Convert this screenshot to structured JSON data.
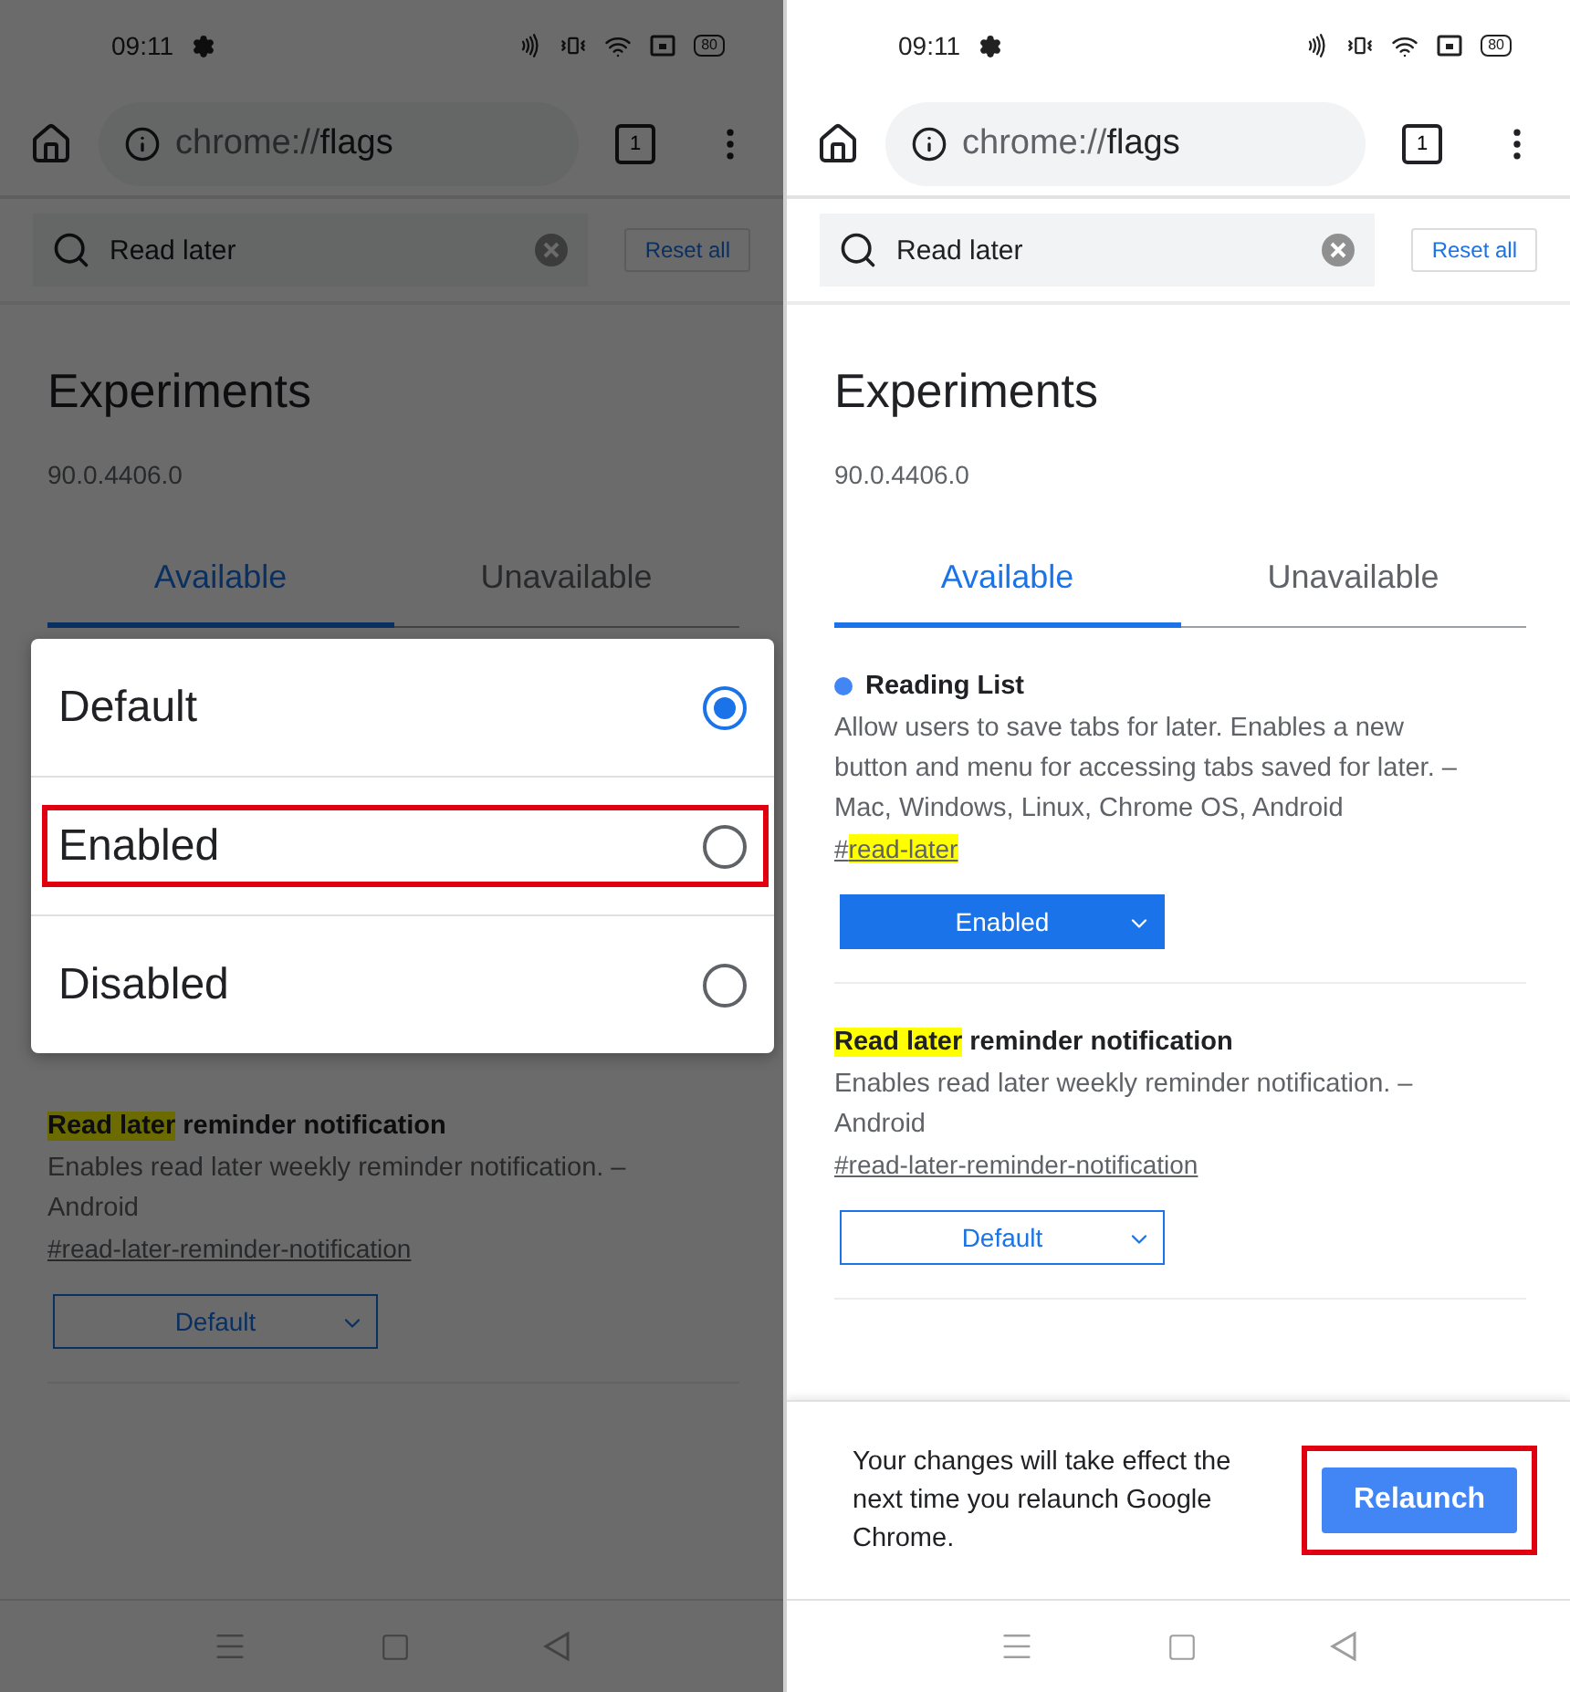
{
  "screens": [
    {
      "dimmed": true,
      "status": {
        "time": "09:11",
        "battery": "80"
      },
      "toolbar": {
        "url_scheme": "chrome://",
        "url_path": "flags",
        "tab_count": "1"
      },
      "search": {
        "value": "Read later",
        "reset_label": "Reset all"
      },
      "title": "Experiments",
      "version": "90.0.4406.0",
      "tabs": [
        {
          "label": "Available",
          "selected": true
        },
        {
          "label": "Unavailable",
          "selected": false
        }
      ],
      "dialog": {
        "options": [
          {
            "label": "Default",
            "selected": true,
            "annotated": false
          },
          {
            "label": "Enabled",
            "selected": false,
            "annotated": true
          },
          {
            "label": "Disabled",
            "selected": false,
            "annotated": false
          }
        ]
      },
      "flags": [
        {
          "modified": false,
          "title_parts": [
            {
              "text": "Read later",
              "highlighted": true
            },
            {
              "text": " reminder notification",
              "highlighted": false
            }
          ],
          "description": "Enables read later weekly reminder notification. – Android",
          "link_parts": [
            {
              "text": "#read-later-reminder-notification",
              "highlighted": false
            }
          ],
          "value": "Default"
        }
      ]
    },
    {
      "dimmed": false,
      "status": {
        "time": "09:11",
        "battery": "80"
      },
      "toolbar": {
        "url_scheme": "chrome://",
        "url_path": "flags",
        "tab_count": "1"
      },
      "search": {
        "value": "Read later",
        "reset_label": "Reset all"
      },
      "title": "Experiments",
      "version": "90.0.4406.0",
      "tabs": [
        {
          "label": "Available",
          "selected": true
        },
        {
          "label": "Unavailable",
          "selected": false
        }
      ],
      "flags": [
        {
          "modified": true,
          "title_parts": [
            {
              "text": "Reading List",
              "highlighted": false
            }
          ],
          "description": "Allow users to save tabs for later. Enables a new button and menu for accessing tabs saved for later. – Mac, Windows, Linux, Chrome OS, Android",
          "link_parts": [
            {
              "text": "#",
              "highlighted": false
            },
            {
              "text": "read-later",
              "highlighted": true
            }
          ],
          "value": "Enabled"
        },
        {
          "modified": false,
          "title_parts": [
            {
              "text": "Read later",
              "highlighted": true
            },
            {
              "text": " reminder notification",
              "highlighted": false
            }
          ],
          "description": "Enables read later weekly reminder notification. – Android",
          "link_parts": [
            {
              "text": "#read-later-reminder-notification",
              "highlighted": false
            }
          ],
          "value": "Default"
        }
      ],
      "relaunch": {
        "message": "Your changes will take effect the next time you relaunch Google Chrome.",
        "button": "Relaunch",
        "annotated": true
      }
    }
  ]
}
